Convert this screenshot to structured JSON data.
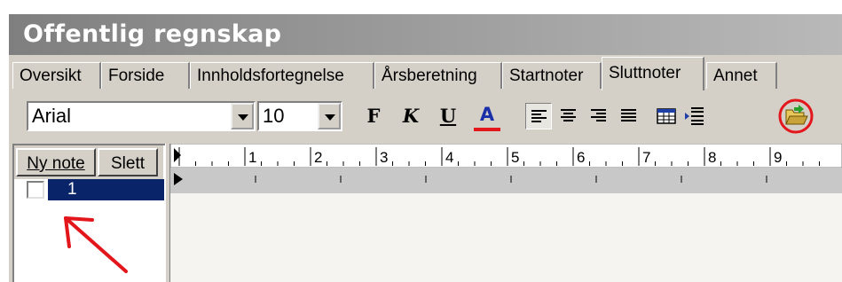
{
  "window": {
    "title": "Offentlig regnskap"
  },
  "tabs": [
    {
      "label": "Oversikt",
      "active": false
    },
    {
      "label": "Forside",
      "active": false
    },
    {
      "label": "Innholdsfortegnelse",
      "active": false
    },
    {
      "label": "Årsberetning",
      "active": false
    },
    {
      "label": "Startnoter",
      "active": false
    },
    {
      "label": "Sluttnoter",
      "active": true
    },
    {
      "label": "Annet",
      "active": false
    }
  ],
  "toolbar": {
    "font": "Arial",
    "size": "10",
    "bold": "F",
    "italic": "K",
    "underline": "U",
    "color": "A",
    "icons": [
      "align-left-icon",
      "align-center-icon",
      "align-right-icon",
      "justify-icon",
      "table-icon",
      "insert-rows-icon",
      "open-folder-icon"
    ]
  },
  "notes": {
    "new_button": "Ny note",
    "delete_button": "Slett",
    "items": [
      {
        "label": "1",
        "checked": false,
        "selected": true
      }
    ]
  },
  "ruler": {
    "labels": [
      "1",
      "2",
      "3",
      "4",
      "5",
      "6",
      "7",
      "8",
      "9"
    ]
  },
  "colors": {
    "selection": "#0a246a",
    "annotation": "#e3161b",
    "font_color_underline": "#e3161b"
  }
}
